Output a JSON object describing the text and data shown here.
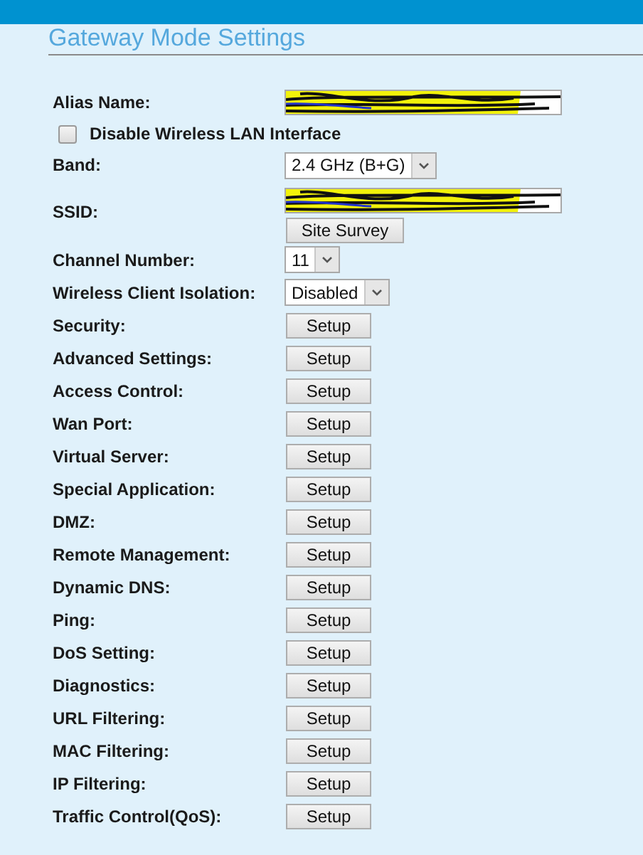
{
  "header": {
    "title": "Gateway Mode Settings"
  },
  "fields": [
    {
      "kind": "text",
      "label": "Alias Name:",
      "redacted": true
    },
    {
      "kind": "checkbox",
      "label": "Disable Wireless LAN Interface",
      "checked": false
    },
    {
      "kind": "select",
      "label": "Band:",
      "value": "2.4 GHz (B+G)"
    },
    {
      "kind": "ssid",
      "label": "SSID:",
      "redacted": true,
      "button": "Site Survey"
    },
    {
      "kind": "select",
      "label": "Channel Number:",
      "value": "11"
    },
    {
      "kind": "select",
      "label": "Wireless Client Isolation:",
      "value": "Disabled"
    },
    {
      "kind": "button",
      "label": "Security:",
      "button": "Setup"
    },
    {
      "kind": "button",
      "label": "Advanced Settings:",
      "button": "Setup"
    },
    {
      "kind": "button",
      "label": "Access Control:",
      "button": "Setup"
    },
    {
      "kind": "button",
      "label": "Wan Port:",
      "button": "Setup"
    },
    {
      "kind": "button",
      "label": "Virtual Server:",
      "button": "Setup"
    },
    {
      "kind": "button",
      "label": "Special Application:",
      "button": "Setup"
    },
    {
      "kind": "button",
      "label": "DMZ:",
      "button": "Setup"
    },
    {
      "kind": "button",
      "label": "Remote Management:",
      "button": "Setup"
    },
    {
      "kind": "button",
      "label": "Dynamic DNS:",
      "button": "Setup"
    },
    {
      "kind": "button",
      "label": "Ping:",
      "button": "Setup"
    },
    {
      "kind": "button",
      "label": "DoS Setting:",
      "button": "Setup"
    },
    {
      "kind": "button",
      "label": "Diagnostics:",
      "button": "Setup"
    },
    {
      "kind": "button",
      "label": "URL Filtering:",
      "button": "Setup"
    },
    {
      "kind": "button",
      "label": "MAC Filtering:",
      "button": "Setup"
    },
    {
      "kind": "button",
      "label": "IP Filtering:",
      "button": "Setup"
    },
    {
      "kind": "button",
      "label": "Traffic Control(QoS):",
      "button": "Setup"
    }
  ]
}
